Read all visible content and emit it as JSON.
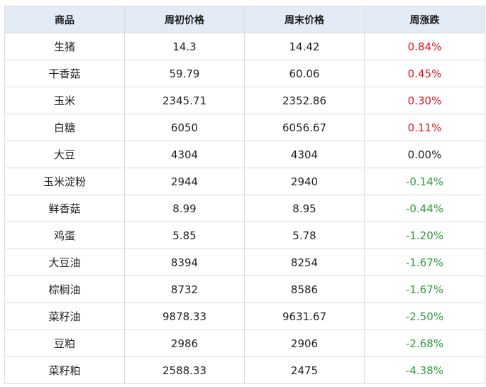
{
  "table": {
    "headers": [
      "商品",
      "周初价格",
      "周末价格",
      "周涨跌"
    ],
    "rows": [
      {
        "name": "生猪",
        "start": "14.3",
        "end": "14.42",
        "change": "0.84%",
        "trend": "up"
      },
      {
        "name": "干香菇",
        "start": "59.79",
        "end": "60.06",
        "change": "0.45%",
        "trend": "up"
      },
      {
        "name": "玉米",
        "start": "2345.71",
        "end": "2352.86",
        "change": "0.30%",
        "trend": "up"
      },
      {
        "name": "白糖",
        "start": "6050",
        "end": "6056.67",
        "change": "0.11%",
        "trend": "up"
      },
      {
        "name": "大豆",
        "start": "4304",
        "end": "4304",
        "change": "0.00%",
        "trend": "flat"
      },
      {
        "name": "玉米淀粉",
        "start": "2944",
        "end": "2940",
        "change": "-0.14%",
        "trend": "down"
      },
      {
        "name": "鲜香菇",
        "start": "8.99",
        "end": "8.95",
        "change": "-0.44%",
        "trend": "down"
      },
      {
        "name": "鸡蛋",
        "start": "5.85",
        "end": "5.78",
        "change": "-1.20%",
        "trend": "down"
      },
      {
        "name": "大豆油",
        "start": "8394",
        "end": "8254",
        "change": "-1.67%",
        "trend": "down"
      },
      {
        "name": "棕榈油",
        "start": "8732",
        "end": "8586",
        "change": "-1.67%",
        "trend": "down"
      },
      {
        "name": "菜籽油",
        "start": "9878.33",
        "end": "9631.67",
        "change": "-2.50%",
        "trend": "down"
      },
      {
        "name": "豆粕",
        "start": "2986",
        "end": "2906",
        "change": "-2.68%",
        "trend": "down"
      },
      {
        "name": "菜籽粕",
        "start": "2588.33",
        "end": "2475",
        "change": "-4.38%",
        "trend": "down"
      }
    ]
  },
  "colors": {
    "header_bg": "#e3ebf7",
    "up": "#e0141e",
    "down": "#2e9a40",
    "flat": "#222222",
    "border": "#dcdcdc"
  }
}
